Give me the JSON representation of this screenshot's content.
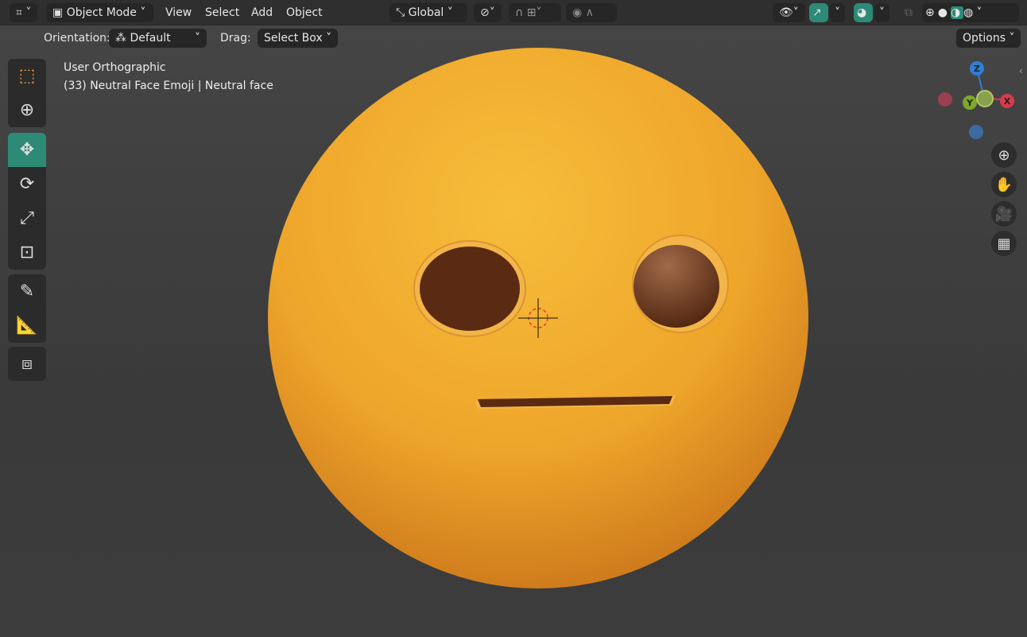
{
  "header": {
    "mode": "Object Mode",
    "menus": [
      "View",
      "Select",
      "Add",
      "Object"
    ],
    "transform_orientation": "Global"
  },
  "tool_settings": {
    "orientation_label": "Orientation:",
    "orientation_value": "Default",
    "drag_label": "Drag:",
    "drag_value": "Select Box",
    "options": "Options"
  },
  "viewport": {
    "view_name": "User Orthographic",
    "object_info": "(33) Neutral Face Emoji | Neutral face"
  },
  "gizmo": {
    "x": "X",
    "y": "Y",
    "z": "Z"
  },
  "colors": {
    "accent": "#2c8a77",
    "emoji": "#f0a92a",
    "eye": "#5a2a12"
  }
}
